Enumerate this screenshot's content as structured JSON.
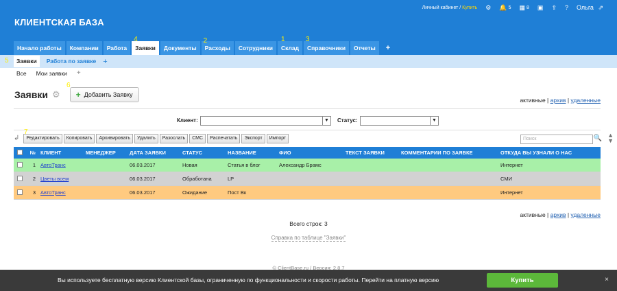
{
  "topbar": {
    "cabinet": "Личный кабинет",
    "sep": " / ",
    "buy": "Купить",
    "settings_icon": "gear-icon",
    "notify_count": "5",
    "calendar_count": "8",
    "user": "Ольга"
  },
  "brand": "КЛИЕНТСКАЯ БАЗА",
  "tabs": [
    {
      "label": "Начало работы"
    },
    {
      "label": "Компании"
    },
    {
      "label": "Работа"
    },
    {
      "label": "Заявки",
      "marker": "4"
    },
    {
      "label": "Документы"
    },
    {
      "label": "Расходы",
      "marker": "2"
    },
    {
      "label": "Сотрудники"
    },
    {
      "label": "Склад",
      "marker": "1"
    },
    {
      "label": "Справочники",
      "marker": "3"
    },
    {
      "label": "Отчеты"
    }
  ],
  "tab_plus": "+",
  "subnav": {
    "marker": "5",
    "items": [
      {
        "label": "Заявки"
      },
      {
        "label": "Работа по заявке"
      }
    ],
    "plus": "+"
  },
  "filters2": {
    "items": [
      {
        "label": "Все"
      },
      {
        "label": "Мои заявки"
      }
    ],
    "plus": "+"
  },
  "page": {
    "title": "Заявки",
    "add_marker": "6",
    "add_button": "Добавить Заявку"
  },
  "view_links": {
    "active": "активные",
    "archive": "архив",
    "deleted": "удаленные",
    "sep": " | "
  },
  "filters": {
    "client_label": "Клиент:",
    "status_label": "Статус:",
    "client_value": "",
    "status_value": ""
  },
  "toolbar": {
    "marker": "7",
    "buttons": [
      "Редактировать",
      "Копировать",
      "Архивировать",
      "Удалить",
      "Разослать",
      "СМС",
      "Распечатать",
      "Экспорт",
      "Импорт"
    ],
    "search_placeholder": "Поиск"
  },
  "table": {
    "headers": [
      "№",
      "КЛИЕНТ",
      "МЕНЕДЖЕР",
      "ДАТА ЗАЯВКИ",
      "СТАТУС",
      "НАЗВАНИЕ",
      "ФИО",
      "ТЕКСТ ЗАЯВКИ",
      "КОММЕНТАРИИ ПО ЗАЯВКЕ",
      "ОТКУДА ВЫ УЗНАЛИ О НАС"
    ],
    "rows": [
      {
        "num": "1",
        "client": "АвтоТранс",
        "manager": "",
        "date": "06.03.2017",
        "status": "Новая",
        "name": "Статья в блог",
        "fio": "Александр Брамс",
        "text": "",
        "comments": "",
        "source": "Интернет",
        "color": "#a8f0a8"
      },
      {
        "num": "2",
        "client": "Цветы всем",
        "manager": "",
        "date": "06.03.2017",
        "status": "Обработана",
        "name": "LP",
        "fio": "",
        "text": "",
        "comments": "",
        "source": "СМИ",
        "color": "#d2d2d2"
      },
      {
        "num": "3",
        "client": "АвтоТранс",
        "manager": "",
        "date": "06.03.2017",
        "status": "Ожидание",
        "name": "Пост Вк",
        "fio": "",
        "text": "",
        "comments": "",
        "source": "Интернет",
        "color": "#ffca80"
      }
    ]
  },
  "total": "Всего строк: 3",
  "help": "Справка по таблице \"Заявки\"",
  "footer": "© ClientBase.ru / Версия: 2.8.7",
  "banner": {
    "message": "Вы используете бесплатную версию Клиентской базы, ограниченную по функциональности и скорости работы. Перейти на платную версию",
    "buy": "Купить",
    "close": "×"
  }
}
